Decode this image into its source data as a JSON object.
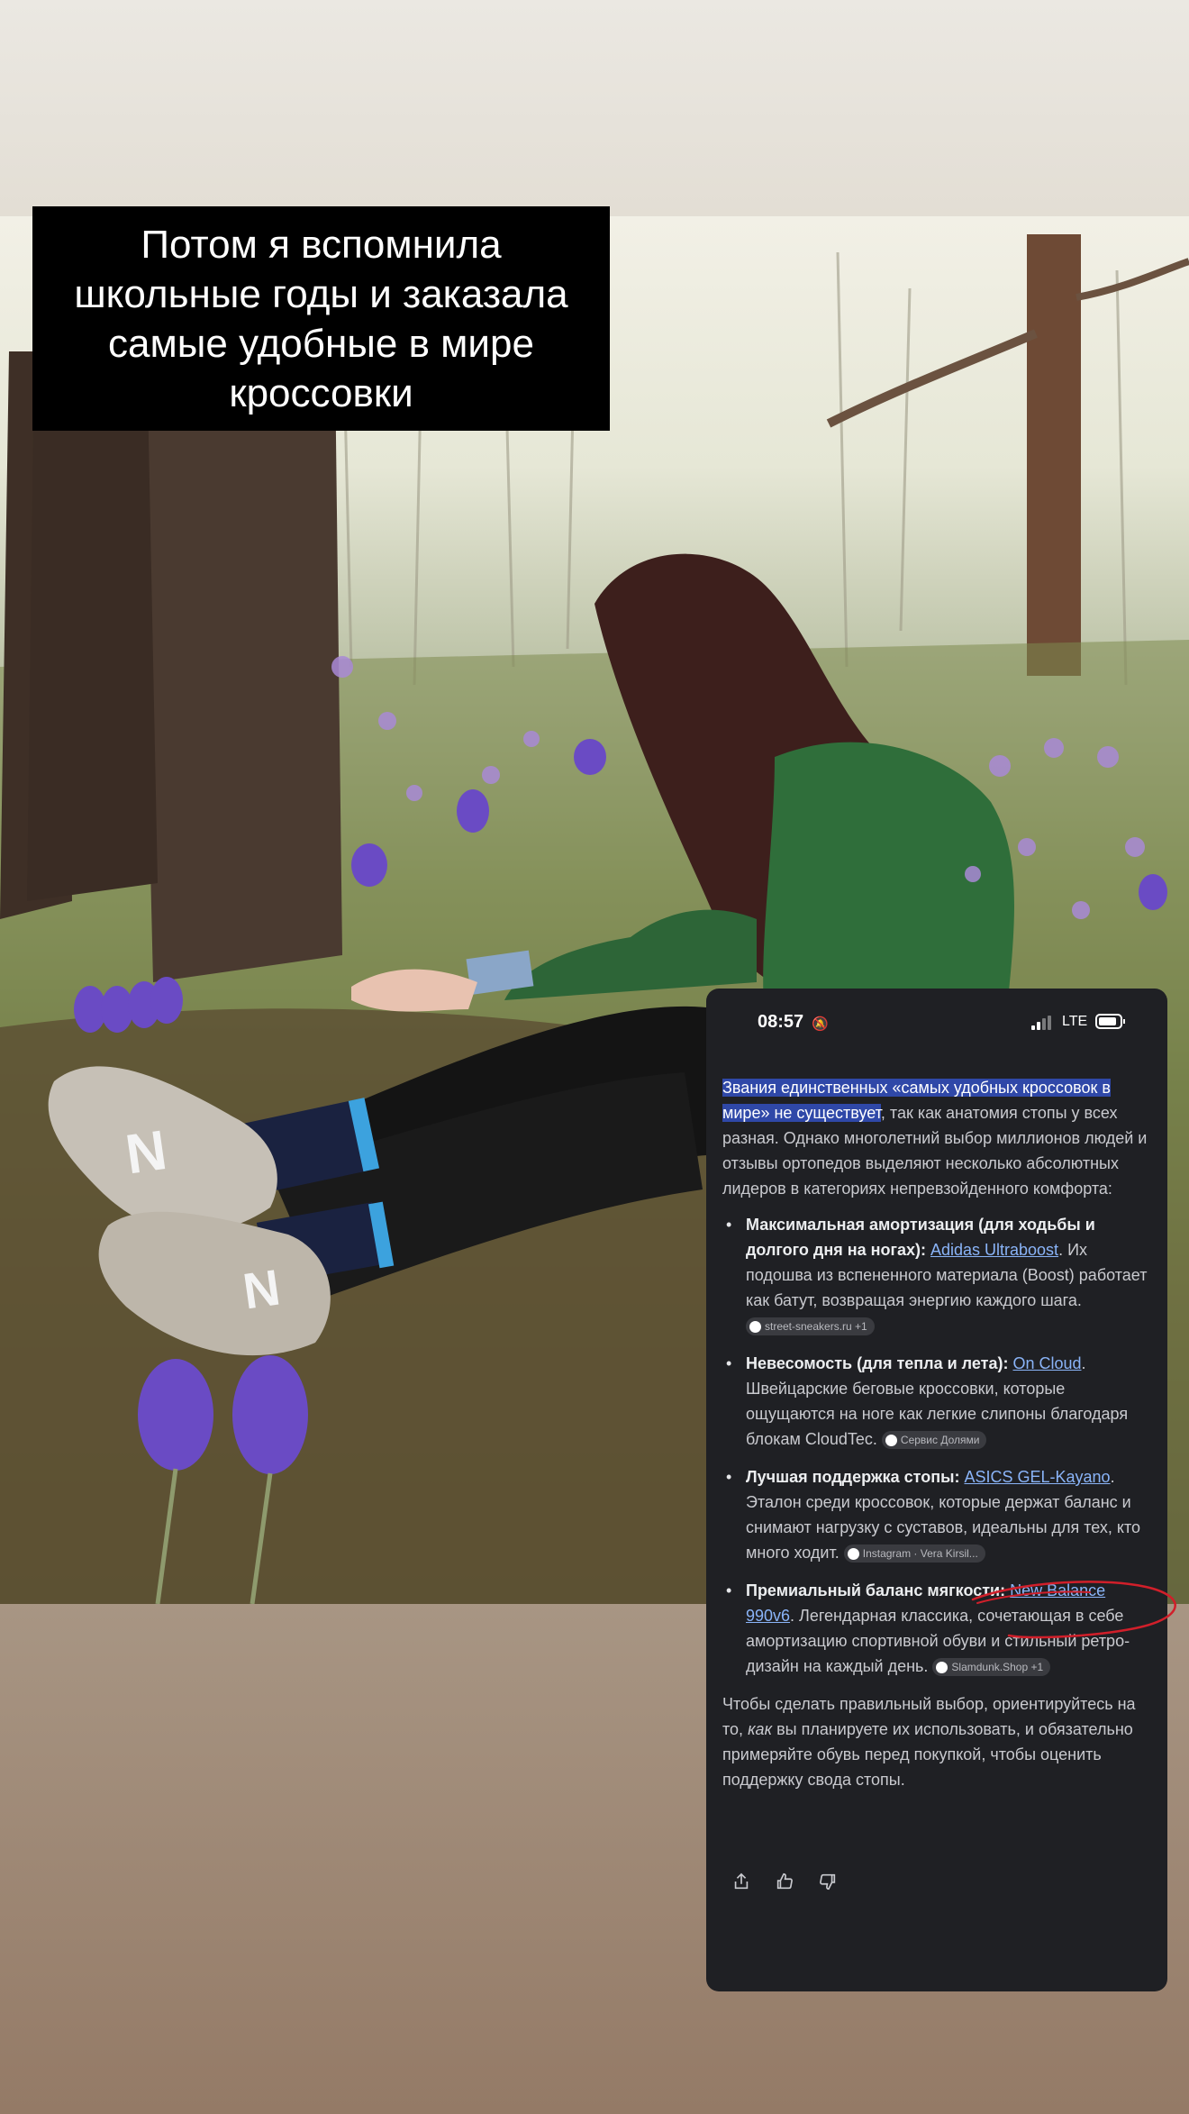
{
  "caption": {
    "text": "Потом я вспомнила\nшкольные годы и заказала\nсамые удобные  в мире\nкроссовки"
  },
  "phone": {
    "status_bar": {
      "time": "08:57",
      "network": "LTE"
    },
    "intro": {
      "highlight": "Звания единственных «самых удобных кроссовок в мире» не существует",
      "rest": ", так как анатомия стопы у всех разная. Однако многолетний выбор миллионов людей и отзывы ортопедов выделяют несколько абсолютных лидеров в категориях непревзойденного комфорта:"
    },
    "items": [
      {
        "title": "Максимальная амортизация (для ходьбы и долгого дня на ногах): ",
        "link": "Adidas Ultraboost",
        "text": ". Их подошва из вспененного материала (Boost) работает как батут, возвращая энергию каждого шага. ",
        "source": "street-sneakers.ru +1"
      },
      {
        "title": "Невесомость (для тепла и лета): ",
        "link": "On Cloud",
        "text": ". Швейцарские беговые кроссовки, которые ощущаются на ноге как легкие слипоны благодаря блокам CloudTec. ",
        "source": "Сервис Долями"
      },
      {
        "title": "Лучшая поддержка стопы: ",
        "link": "ASICS GEL-Kayano",
        "text": ". Эталон среди кроссовок, которые держат баланс и снимают нагрузку с суставов, идеальны для тех, кто много ходит. ",
        "source": "Instagram · Vera Kirsil..."
      },
      {
        "title": "Премиальный баланс мягкости: ",
        "link": "New Balance 990v6",
        "text": ". Легендарная классика, сочетающая в себе амортизацию спортивной обуви и стильный ретро-дизайн на каждый день. ",
        "source": "Slamdunk.Shop +1"
      }
    ],
    "closing": {
      "before": "Чтобы сделать правильный выбор, ориентируйтесь на то, ",
      "italic": "как",
      "after": " вы планируете их использовать, и обязательно примеряйте обувь перед покупкой, чтобы оценить поддержку свода стопы."
    },
    "actions": [
      "share-icon",
      "thumbs-up-icon",
      "thumbs-down-icon"
    ]
  },
  "colors": {
    "card_bg": "#1f2024",
    "highlight": "#2f48a8",
    "link": "#8ab4f8",
    "annotation": "#d11f2a"
  }
}
